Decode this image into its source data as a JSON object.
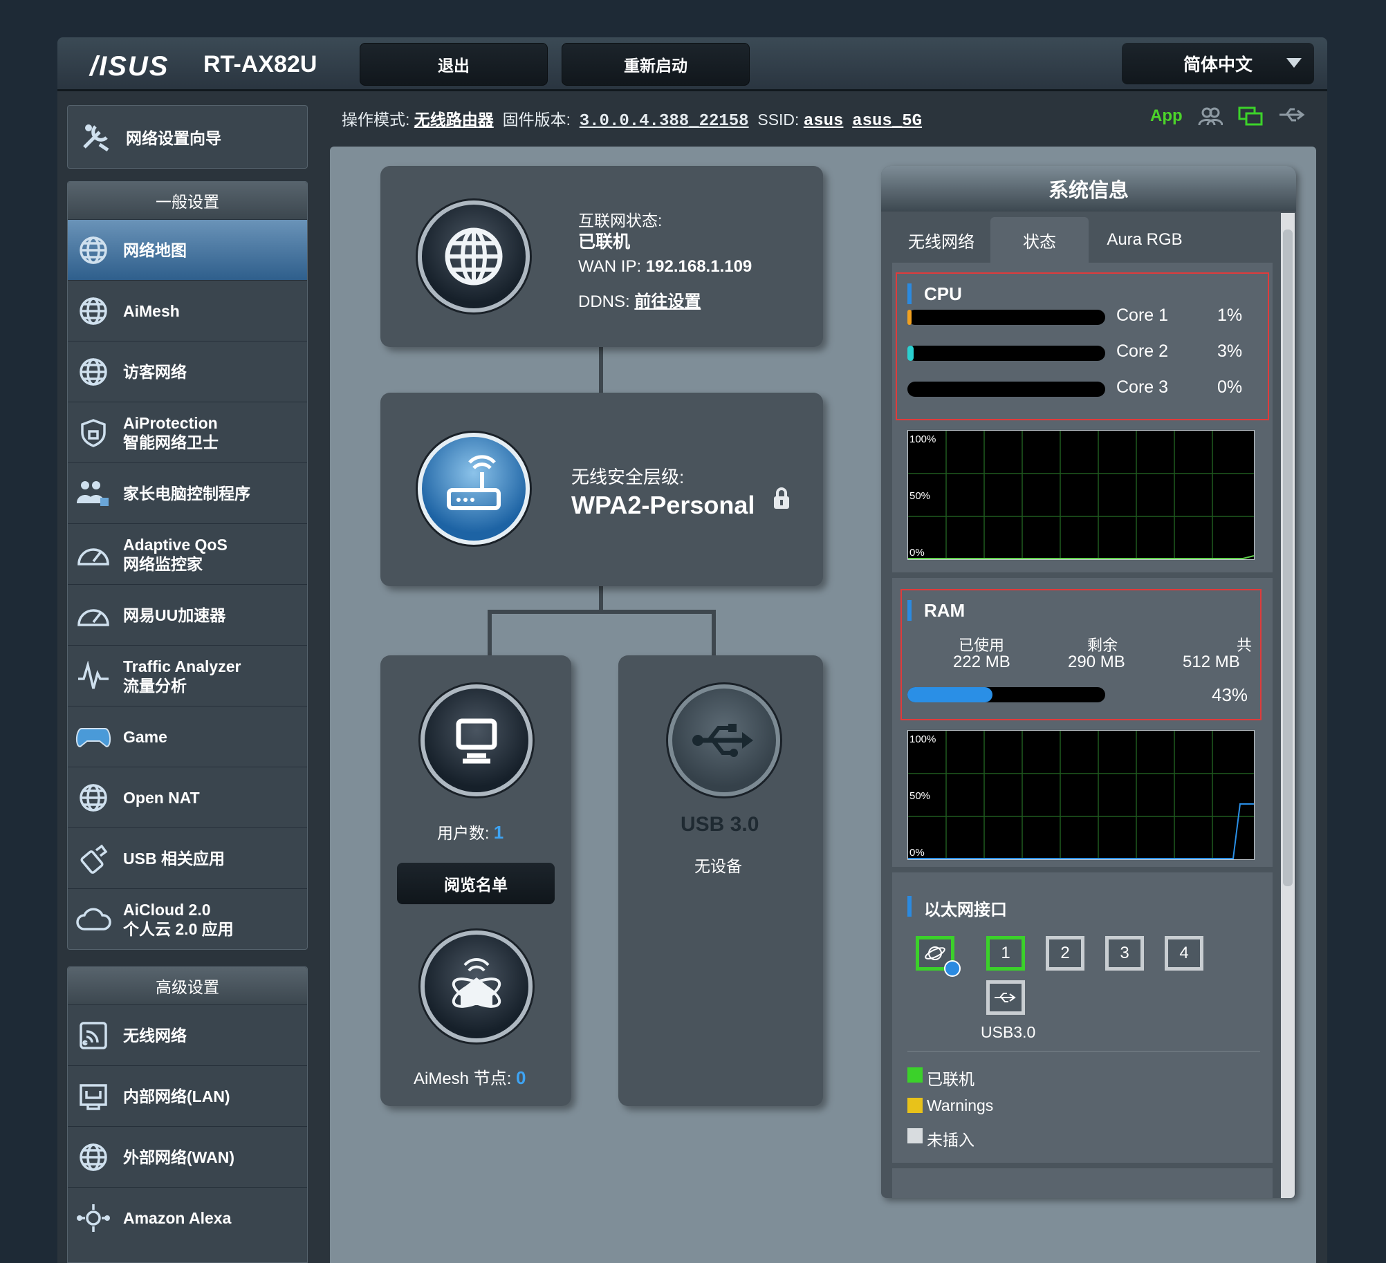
{
  "header": {
    "logo": "/ISUS",
    "model": "RT-AX82U",
    "logout": "退出",
    "reboot": "重新启动",
    "language": "简体中文"
  },
  "infobar": {
    "mode_label": "操作模式:",
    "mode_value": "无线路由器",
    "fw_label": "固件版本:",
    "fw_value": "3.0.0.4.388_22158",
    "ssid_label": "SSID:",
    "ssid_1": "asus",
    "ssid_2": "asus_5G",
    "app_label": "App"
  },
  "sidebar": {
    "wizard": "网络设置向导",
    "general_title": "一般设置",
    "general_items": [
      {
        "label": "网络地图",
        "label2": ""
      },
      {
        "label": "AiMesh",
        "label2": ""
      },
      {
        "label": "访客网络",
        "label2": ""
      },
      {
        "label": "AiProtection",
        "label2": "智能网络卫士"
      },
      {
        "label": "家长电脑控制程序",
        "label2": ""
      },
      {
        "label": "Adaptive QoS",
        "label2": "网络监控家"
      },
      {
        "label": "网易UU加速器",
        "label2": ""
      },
      {
        "label": "Traffic Analyzer",
        "label2": "流量分析"
      },
      {
        "label": "Game",
        "label2": ""
      },
      {
        "label": "Open NAT",
        "label2": ""
      },
      {
        "label": "USB 相关应用",
        "label2": ""
      },
      {
        "label": "AiCloud 2.0",
        "label2": "个人云 2.0 应用"
      }
    ],
    "advanced_title": "高级设置",
    "advanced_items": [
      {
        "label": "无线网络"
      },
      {
        "label": "内部网络(LAN)"
      },
      {
        "label": "外部网络(WAN)"
      },
      {
        "label": "Amazon Alexa"
      }
    ]
  },
  "map": {
    "internet_label": "互联网状态:",
    "internet_status": "已联机",
    "wan_ip_label": "WAN IP:",
    "wan_ip": "192.168.1.109",
    "ddns_label": "DDNS:",
    "ddns_value": "前往设置",
    "security_label": "无线安全层级:",
    "security_value": "WPA2-Personal",
    "clients_label": "用户数:",
    "clients_count": "1",
    "view_list": "阅览名单",
    "aimesh_label": "AiMesh 节点:",
    "aimesh_count": "0",
    "usb_label": "USB 3.0",
    "usb_status": "无设备"
  },
  "sysinfo": {
    "title": "系统信息",
    "tabs": [
      "无线网络",
      "状态",
      "Aura RGB"
    ],
    "cpu": {
      "title": "CPU",
      "cores": [
        {
          "name": "Core 1",
          "pct_text": "1%",
          "pct": 1,
          "color": "#f0a020"
        },
        {
          "name": "Core 2",
          "pct_text": "3%",
          "pct": 3,
          "color": "#2ad0d0"
        },
        {
          "name": "Core 3",
          "pct_text": "0%",
          "pct": 0,
          "color": "#2b8ae0"
        }
      ],
      "graph_labels": [
        "100%",
        "50%",
        "0%"
      ]
    },
    "ram": {
      "title": "RAM",
      "used_label": "已使用",
      "used": "222 MB",
      "free_label": "剩余",
      "free": "290 MB",
      "total_label": "共",
      "total": "512 MB",
      "pct_text": "43%",
      "pct": 43,
      "graph_labels": [
        "100%",
        "50%",
        "0%"
      ]
    },
    "ethernet": {
      "title": "以太网接口",
      "ports": [
        "1",
        "2",
        "3",
        "4"
      ],
      "usb_port": "USB3.0",
      "legend": [
        {
          "label": "已联机",
          "color": "#3bd12a"
        },
        {
          "label": "Warnings",
          "color": "#e8c21a"
        },
        {
          "label": "未插入",
          "color": "#d8dcdf"
        }
      ]
    }
  },
  "colors": {
    "accent_blue": "#2b8ae0",
    "connected_green": "#3bd12a",
    "alert_red": "#e03b3b"
  }
}
